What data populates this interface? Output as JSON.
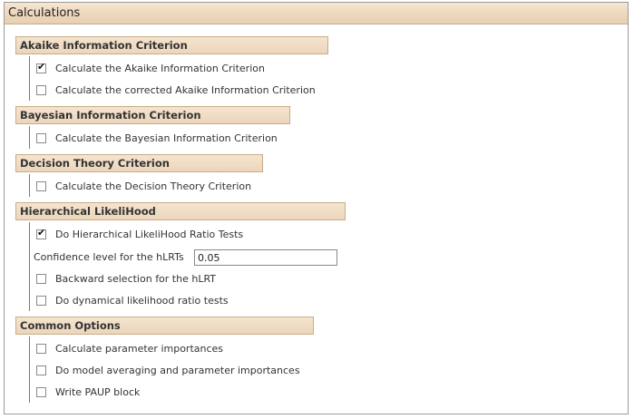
{
  "panel": {
    "title": "Calculations"
  },
  "sections": {
    "aic": {
      "title": "Akaike Information Criterion",
      "options": [
        {
          "label": "Calculate the Akaike Information Criterion",
          "checked": true
        },
        {
          "label": "Calculate the corrected Akaike Information Criterion",
          "checked": false
        }
      ]
    },
    "bic": {
      "title": "Bayesian Information Criterion",
      "options": [
        {
          "label": "Calculate the Bayesian Information Criterion",
          "checked": false
        }
      ]
    },
    "dt": {
      "title": "Decision Theory Criterion",
      "options": [
        {
          "label": "Calculate the Decision Theory Criterion",
          "checked": false
        }
      ]
    },
    "hlrt": {
      "title": "Hierarchical LikeliHood",
      "options": [
        {
          "label": "Do Hierarchical LikeliHood Ratio Tests",
          "checked": true
        },
        {
          "label": "Backward selection for the hLRT",
          "checked": false
        },
        {
          "label": "Do dynamical likelihood ratio tests",
          "checked": false
        }
      ],
      "confidence": {
        "label": "Confidence level for the hLRTs",
        "value": "0.05"
      }
    },
    "common": {
      "title": "Common Options",
      "options": [
        {
          "label": "Calculate parameter importances",
          "checked": false
        },
        {
          "label": "Do model averaging and parameter importances",
          "checked": false
        },
        {
          "label": "Write PAUP block",
          "checked": false
        }
      ]
    }
  },
  "check_glyph": "✔"
}
